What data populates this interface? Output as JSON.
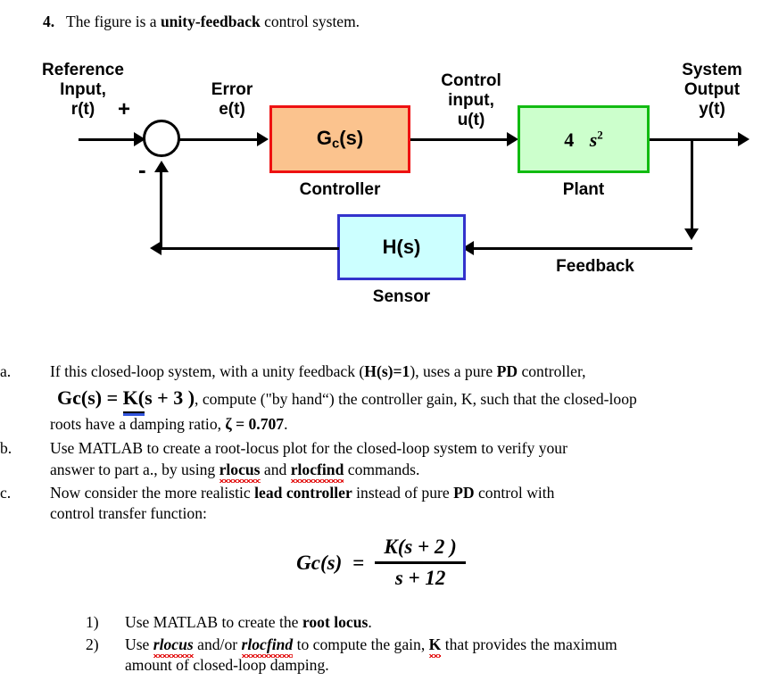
{
  "question": {
    "number": "4.",
    "text_before": "The figure is a ",
    "text_bold": "unity-feedback",
    "text_after": " control system."
  },
  "diagram": {
    "labels": {
      "reference_input": "Reference\nInput,\nr(t)",
      "reference_input_line1": "Reference",
      "reference_input_line2": "Input,",
      "reference_input_line3": "r(t)",
      "plus_sign": "+",
      "minus_sign": "-",
      "error_line1": "Error",
      "error_line2": "e(t)",
      "control_line1": "Control",
      "control_line2": "input,",
      "control_line3": "u(t)",
      "system_output_line1": "System",
      "system_output_line2": "Output",
      "system_output_line3": "y(t)",
      "feedback": "Feedback"
    },
    "blocks": {
      "controller": {
        "formula_main": "G",
        "formula_sub": "c",
        "formula_tail": "(s)",
        "caption": "Controller",
        "fill": "#FBC38E",
        "stroke": "#EE1111"
      },
      "plant": {
        "numerator": "4",
        "denominator": "s",
        "denominator_exponent": "2",
        "caption": "Plant",
        "fill": "#CCFFCC",
        "stroke": "#11BB11"
      },
      "sensor": {
        "formula": "H(s)",
        "caption": "Sensor",
        "fill": "#CCFFFF",
        "stroke": "#3333CC"
      }
    }
  },
  "parts": {
    "a": {
      "marker": "a.",
      "seg1": "If this closed-loop system, with a unity feedback (",
      "seg2_bold": "H(s)=1",
      "seg3": "), uses a pure ",
      "seg4_bold": "PD",
      "seg5": " controller,",
      "eq_lhs": "Gc(s) = ",
      "eq_underlined": "K(",
      "eq_rest": "s + 3 )",
      "eq_tail": ", compute (\"by hand“) the controller gain, ",
      "eq_tail_bold_k": "K",
      "eq_tail2": ", such that the closed-loop",
      "line3a": "roots have a damping ratio, ",
      "line3_zeta": "ζ = 0.707",
      "line3b": "."
    },
    "b": {
      "marker": "b.",
      "line1": "Use MATLAB to create a root-locus plot for the closed-loop system to verify your",
      "line2a": "answer to part a., by using ",
      "line2_cmd1": "rlocus",
      "line2b": " and ",
      "line2_cmd2": "rlocfind",
      "line2c": " commands."
    },
    "c": {
      "marker": "c.",
      "line1a": "Now consider the more realistic ",
      "line1_bold": "lead controller",
      "line1b": " instead of pure ",
      "line1_bold2": "PD",
      "line1c": " control with",
      "line2": "control transfer function:"
    }
  },
  "lead_equation": {
    "lhs": "Gc(s)",
    "equals": "=",
    "numerator": "K(s + 2 )",
    "denominator": "s + 12"
  },
  "sublist": [
    {
      "marker": "1)",
      "seg1": "Use MATLAB to create the ",
      "seg_bold": "root locus",
      "seg2": "."
    },
    {
      "marker": "2)",
      "seg1": "Use ",
      "cmd1": "rlocus",
      "seg2": " and/or ",
      "cmd2": "rlocfind",
      "seg3": " to compute the gain, ",
      "gain_k": "K",
      "seg4": " that provides the maximum",
      "line2": "amount of closed-loop damping."
    }
  ]
}
